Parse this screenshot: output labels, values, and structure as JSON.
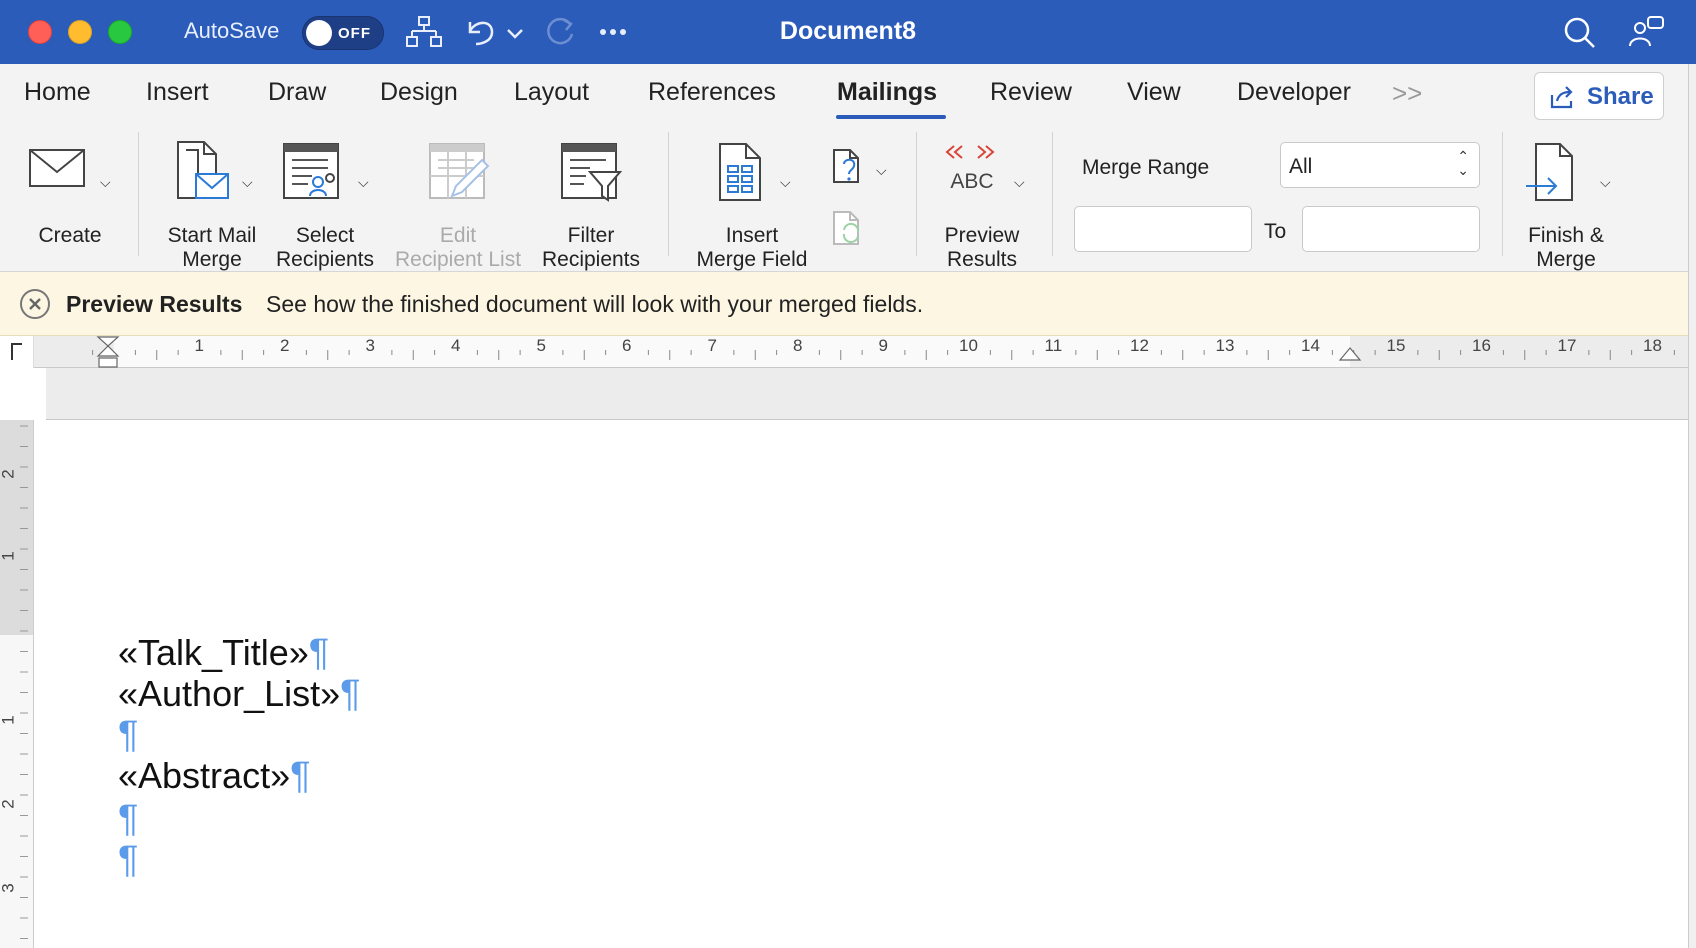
{
  "window": {
    "title": "Document8",
    "autosave_label": "AutoSave",
    "autosave_state": "OFF"
  },
  "tabs": [
    {
      "label": "Home"
    },
    {
      "label": "Insert"
    },
    {
      "label": "Draw"
    },
    {
      "label": "Design"
    },
    {
      "label": "Layout"
    },
    {
      "label": "References"
    },
    {
      "label": "Mailings",
      "active": true
    },
    {
      "label": "Review"
    },
    {
      "label": "View"
    },
    {
      "label": "Developer"
    }
  ],
  "share_label": "Share",
  "ribbon": {
    "create": "Create",
    "start_mail_merge": [
      "Start Mail",
      "Merge"
    ],
    "select_recipients": [
      "Select",
      "Recipients"
    ],
    "edit_recipient_list": [
      "Edit",
      "Recipient List"
    ],
    "filter_recipients": [
      "Filter",
      "Recipients"
    ],
    "insert_merge_field": [
      "Insert",
      "Merge Field"
    ],
    "preview_results": [
      "Preview",
      "Results"
    ],
    "preview_abc": "ABC",
    "merge_range_label": "Merge Range",
    "merge_range_value": "All",
    "to_label": "To",
    "finish_merge": [
      "Finish &",
      "Merge"
    ]
  },
  "infobar": {
    "title": "Preview Results",
    "message": "See how the finished document will look with your merged fields."
  },
  "ruler": {
    "numbers": [
      "1",
      "2",
      "3",
      "4",
      "5",
      "6",
      "7",
      "8",
      "9",
      "10",
      "11",
      "12",
      "13",
      "14",
      "15",
      "16",
      "17",
      "18"
    ],
    "vertical_numbers": [
      "2",
      "1",
      "1",
      "2",
      "3"
    ]
  },
  "document": {
    "lines": [
      "«Talk_Title»",
      "«Author_List»",
      "",
      "«Abstract»",
      "",
      ""
    ],
    "pilcrow": "¶"
  }
}
